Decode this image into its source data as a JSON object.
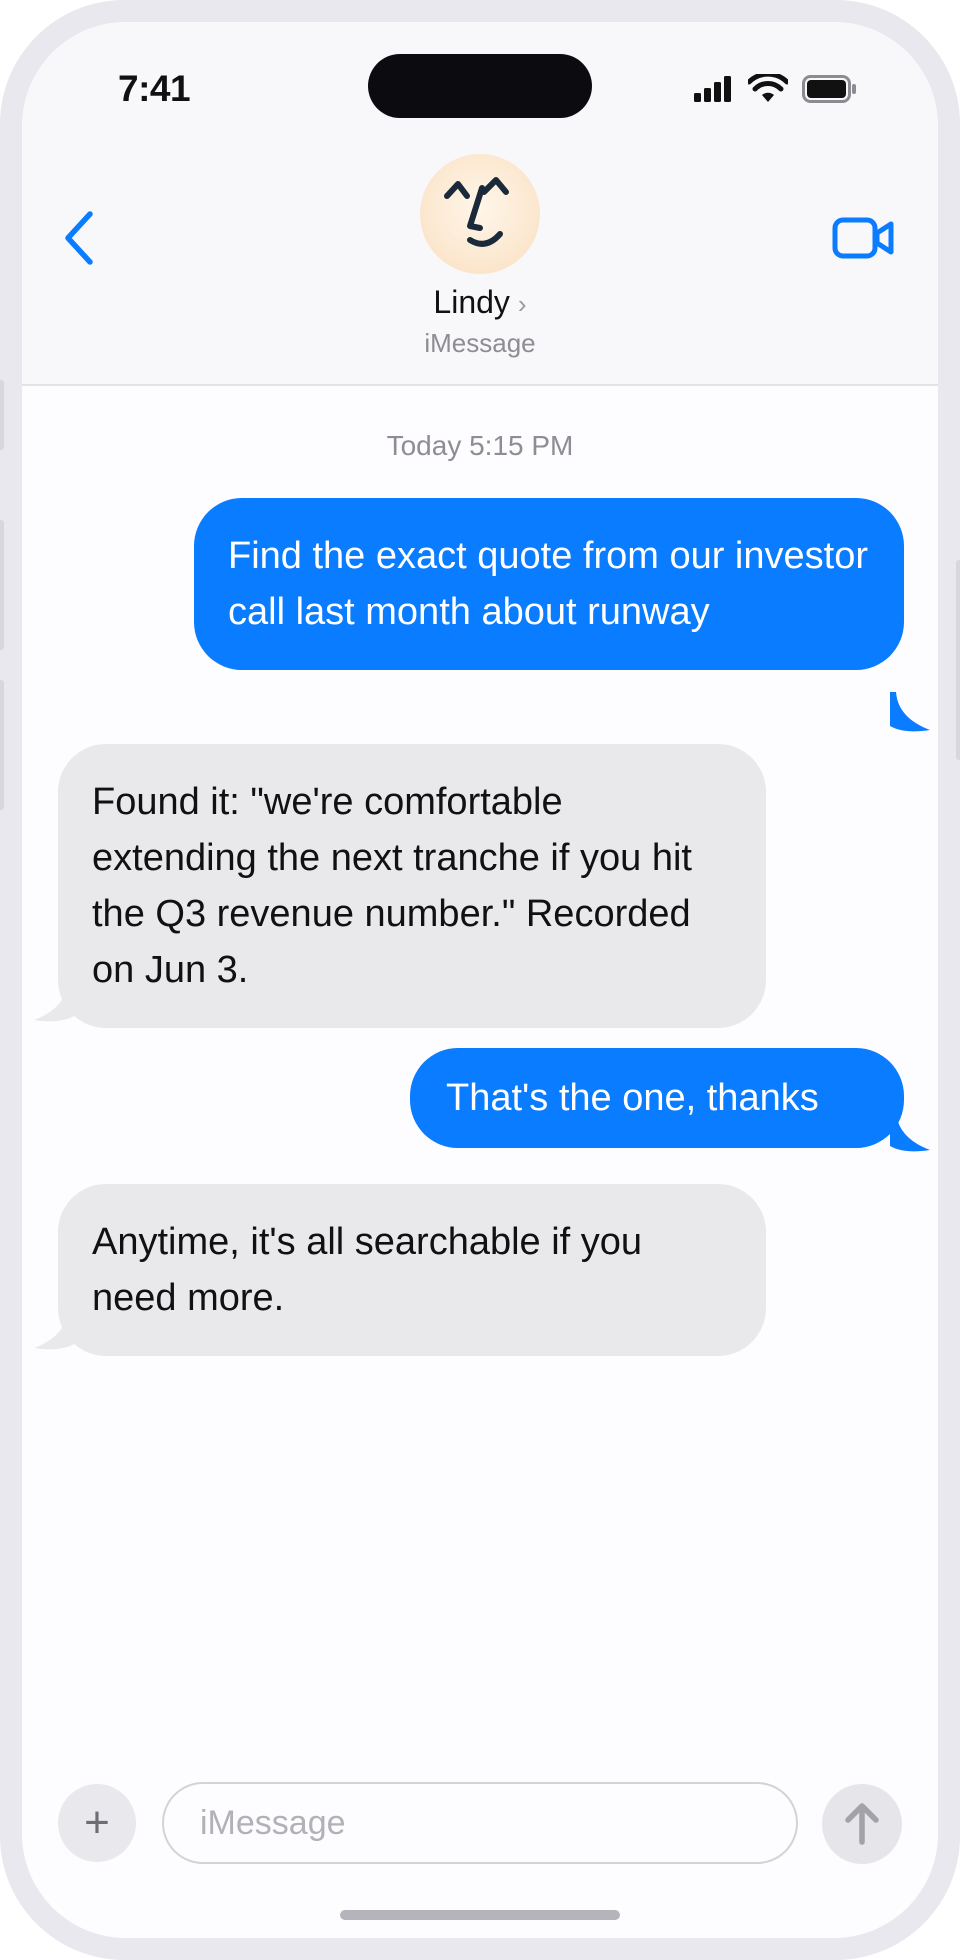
{
  "status": {
    "time": "7:41"
  },
  "header": {
    "contact_name": "Lindy",
    "contact_chevron": "›",
    "service": "iMessage",
    "icons": [
      "back-chevron-icon",
      "video-camera-icon",
      "signal-icon",
      "wifi-icon",
      "battery-icon"
    ]
  },
  "thread": {
    "timestamp": "Today 5:15 PM",
    "messages": [
      {
        "from": "me",
        "text": "Find the exact quote from our investor call last month about runway"
      },
      {
        "from": "Lindy",
        "text": "Found it: \"we're comfortable extending the next tranche if you hit the Q3 revenue number.\" Recorded on Jun 3."
      },
      {
        "from": "me",
        "text": "That's the one, thanks"
      },
      {
        "from": "Lindy",
        "text": "Anytime, it's all searchable if you need more."
      }
    ]
  },
  "composer": {
    "plus_label": "+",
    "placeholder": "iMessage",
    "value": ""
  },
  "colors": {
    "accent": "#0a7cff",
    "incoming_bubble": "#e9e9eb",
    "header_bg": "#f8f7fa"
  }
}
